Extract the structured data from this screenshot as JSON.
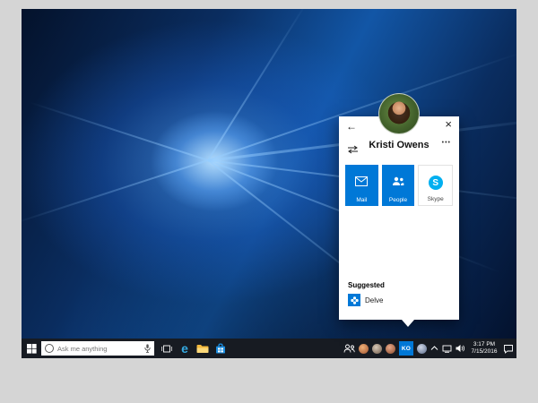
{
  "people_flyout": {
    "back_icon": "←",
    "close_icon": "×",
    "more_icon": "•••",
    "contact_name": "Kristi Owens",
    "apps": [
      {
        "label": "Mail"
      },
      {
        "label": "People"
      },
      {
        "label": "Skype",
        "logo_letter": "S"
      }
    ],
    "suggested_header": "Suggested",
    "suggested_items": [
      {
        "label": "Delve"
      }
    ]
  },
  "taskbar": {
    "search_placeholder": "Ask me anything",
    "contact_badge": "KO",
    "clock": {
      "time": "3:17 PM",
      "date": "7/15/2016"
    }
  },
  "colors": {
    "accent_blue": "#0078d7",
    "skype_blue": "#00aff0",
    "taskbar_background": "#171b22",
    "flyout_background": "#ffffff"
  }
}
